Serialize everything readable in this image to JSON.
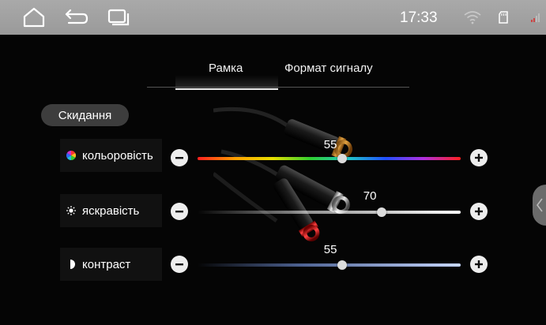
{
  "statusbar": {
    "time": "17:33",
    "icons": [
      "home-icon",
      "back-icon",
      "recent-apps-icon",
      "wifi-icon",
      "sd-card-icon",
      "signal-icon"
    ]
  },
  "tabs": [
    {
      "label": "Рамка",
      "active": true
    },
    {
      "label": "Формат сигналу",
      "active": false
    }
  ],
  "reset_label": "Скидання",
  "sliders": [
    {
      "label": "кольоровість",
      "value": 55,
      "min": 0,
      "max": 100,
      "icon": "color-wheel-icon",
      "track": "rainbow"
    },
    {
      "label": "яскравість",
      "value": 70,
      "min": 0,
      "max": 100,
      "icon": "sun-icon",
      "track": "white-fade"
    },
    {
      "label": "контраст",
      "value": 55,
      "min": 0,
      "max": 100,
      "icon": "contrast-icon",
      "track": "blue-fade"
    }
  ],
  "colors": {
    "statusbar": "#a0a0a0",
    "background": "#050505",
    "button_bg": "#3d3d3d",
    "thumb": "#dcdcdc"
  }
}
